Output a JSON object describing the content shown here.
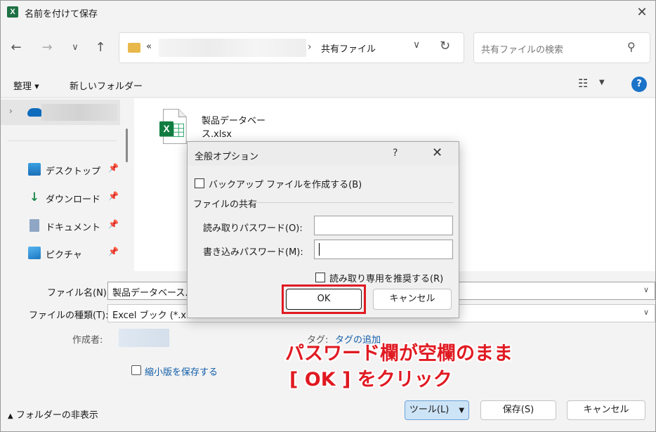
{
  "window": {
    "title": "名前を付けて保存",
    "app_icon_letter": "X"
  },
  "nav": {
    "address_prefix": "«",
    "address_separator": "›",
    "address_path": "共有ファイル",
    "search_placeholder": "共有ファイルの検索"
  },
  "toolbar": {
    "organize_label": "整理 ▾",
    "new_folder_label": "新しいフォルダー"
  },
  "sidebar": {
    "items": [
      {
        "label": "デスクトップ",
        "icon": "desktop-icon"
      },
      {
        "label": "ダウンロード",
        "icon": "download-icon"
      },
      {
        "label": "ドキュメント",
        "icon": "document-icon"
      },
      {
        "label": "ピクチャ",
        "icon": "picture-icon"
      }
    ]
  },
  "files": [
    {
      "name": "製品データベース.xlsx",
      "icon": "excel-file-icon"
    }
  ],
  "form": {
    "filename_label": "ファイル名(N):",
    "filename_value": "製品データベース.xl",
    "filetype_label": "ファイルの種類(T):",
    "filetype_value": "Excel ブック (*.xlsx",
    "author_label": "作成者:",
    "tag_label": "タグ:",
    "tag_value": "タグの追加",
    "thumbnail_label": "縮小版を保存する"
  },
  "footer": {
    "hide_folders_label": "フォルダーの非表示",
    "tools_label": "ツール(L)",
    "save_label": "保存(S)",
    "cancel_label": "キャンセル"
  },
  "dialog": {
    "title": "全般オプション",
    "help": "?",
    "close": "✕",
    "backup_label": "バックアップ ファイルを作成する(B)",
    "sharing_label": "ファイルの共有",
    "read_password_label": "読み取りパスワード(O):",
    "write_password_label": "書き込みパスワード(M):",
    "read_password_value": "",
    "write_password_value": "",
    "recommend_readonly_label": "読み取り専用を推奨する(R)",
    "ok_label": "OK",
    "cancel_label": "キャンセル"
  },
  "annotation": {
    "line1": "パスワード欄が空欄のまま",
    "line2": "[ OK ] をクリック"
  },
  "colors": {
    "annotation_red": "#e01a22",
    "excel_green": "#1e7145",
    "accent_blue": "#0f5ca8"
  }
}
